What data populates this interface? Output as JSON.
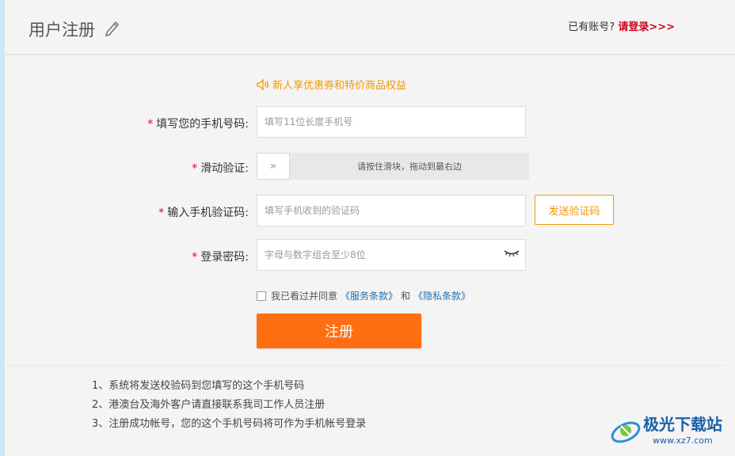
{
  "header": {
    "title": "用户注册",
    "have_account": "已有账号?",
    "login_link": "请登录>>>"
  },
  "promo": {
    "text": "新人享优惠券和特价商品权益"
  },
  "form": {
    "phone": {
      "label": "填写您的手机号码:",
      "placeholder": "填写11位长度手机号"
    },
    "slider": {
      "label": "滑动验证:",
      "hint": "请按住滑块，拖动到最右边",
      "handle": "»"
    },
    "sms": {
      "label": "输入手机验证码:",
      "placeholder": "填写手机收到的验证码",
      "send_button": "发送验证码"
    },
    "password": {
      "label": "登录密码:",
      "placeholder": "字母与数字组合至少8位"
    },
    "agree": {
      "prefix": "我已看过并同意",
      "terms": "《服务条款》",
      "and": "和",
      "privacy": "《隐私条款》",
      "checked": false
    },
    "submit": "注册",
    "required_mark": "*"
  },
  "notes": [
    "1、系统将发送校验码到您填写的这个手机号码",
    "2、港澳台及海外客户请直接联系我司工作人员注册",
    "3、注册成功帐号，您的这个手机号码将可作为手机帐号登录"
  ],
  "watermark": {
    "name": "极光下载站",
    "url": "www.xz7.com"
  },
  "colors": {
    "accent": "#ff6f12",
    "required": "#e60012",
    "link": "#1a6fb3",
    "promo": "#f39800"
  }
}
